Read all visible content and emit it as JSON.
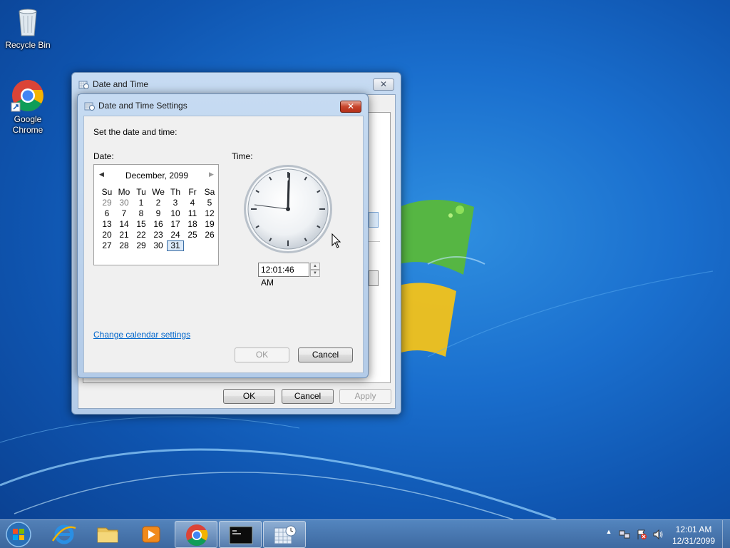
{
  "desktop": {
    "icons": [
      {
        "label": "Recycle Bin"
      },
      {
        "label": "Google Chrome"
      }
    ]
  },
  "outer_window": {
    "title": "Date and Time",
    "close_label": "✕",
    "ok_label": "OK",
    "cancel_label": "Cancel",
    "apply_label": "Apply"
  },
  "dialog": {
    "title": "Date and Time Settings",
    "close_label": "✕",
    "instruction": "Set the date and time:",
    "date_label": "Date:",
    "time_label": "Time:",
    "calendar": {
      "month_label": "December, 2099",
      "prev_arrow": "◀",
      "next_arrow": "▶",
      "weekdays": [
        "Su",
        "Mo",
        "Tu",
        "We",
        "Th",
        "Fr",
        "Sa"
      ],
      "days": [
        {
          "d": "29",
          "other": true
        },
        {
          "d": "30",
          "other": true
        },
        {
          "d": "1"
        },
        {
          "d": "2"
        },
        {
          "d": "3"
        },
        {
          "d": "4"
        },
        {
          "d": "5"
        },
        {
          "d": "6"
        },
        {
          "d": "7"
        },
        {
          "d": "8"
        },
        {
          "d": "9"
        },
        {
          "d": "10"
        },
        {
          "d": "11"
        },
        {
          "d": "12"
        },
        {
          "d": "13"
        },
        {
          "d": "14"
        },
        {
          "d": "15"
        },
        {
          "d": "16"
        },
        {
          "d": "17"
        },
        {
          "d": "18"
        },
        {
          "d": "19"
        },
        {
          "d": "20"
        },
        {
          "d": "21"
        },
        {
          "d": "22"
        },
        {
          "d": "23"
        },
        {
          "d": "24"
        },
        {
          "d": "25"
        },
        {
          "d": "26"
        },
        {
          "d": "27"
        },
        {
          "d": "28"
        },
        {
          "d": "29"
        },
        {
          "d": "30"
        },
        {
          "d": "31",
          "selected": true
        }
      ]
    },
    "time_value": "12:01:46 AM",
    "spin_up": "▲",
    "spin_down": "▼",
    "change_calendar_link": "Change calendar settings",
    "ok_label": "OK",
    "cancel_label": "Cancel"
  },
  "taskbar": {
    "items": [
      "start-orb",
      "internet-explorer",
      "windows-explorer",
      "media-player",
      "google-chrome",
      "command-prompt",
      "date-and-time"
    ],
    "tray_arrow": "▲",
    "time": "12:01 AM",
    "date": "12/31/2099"
  },
  "colors": {
    "accent": "#0066cc",
    "taskbar": "#4a78a8",
    "close_red": "#c7452c"
  }
}
